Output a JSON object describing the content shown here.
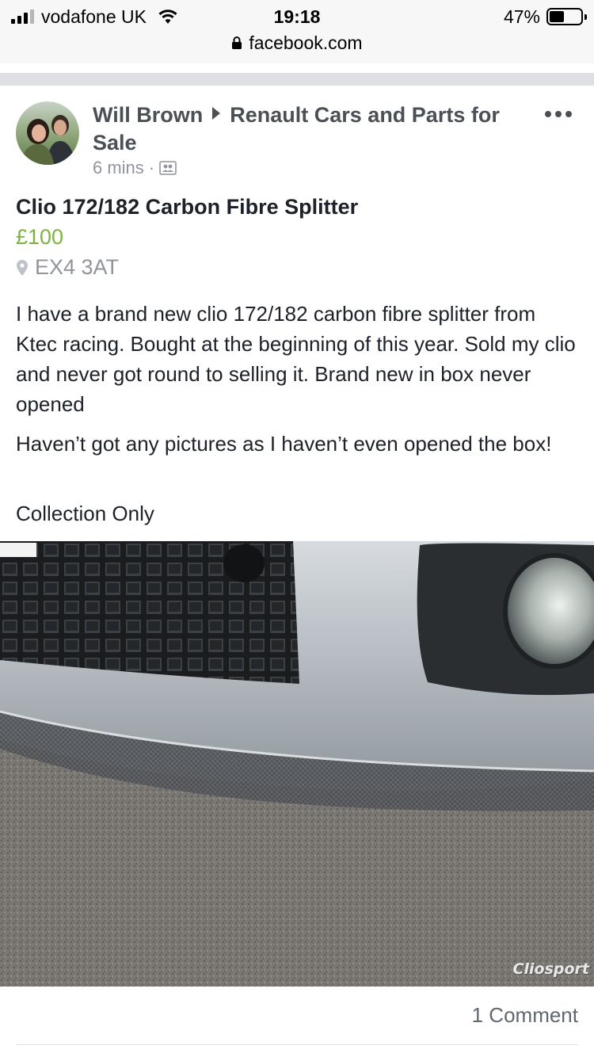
{
  "status_bar": {
    "carrier": "vodafone UK",
    "time": "19:18",
    "battery": "47%",
    "battery_level": 0.47,
    "url": "facebook.com"
  },
  "post": {
    "author": "Will Brown",
    "group": "Renault Cars and Parts for Sale",
    "time": "6 mins",
    "separator": "·",
    "audience_icon": "group-audience-icon",
    "more_icon": "more-options-icon"
  },
  "listing": {
    "title": "Clio 172/182 Carbon Fibre Splitter",
    "price": "£100",
    "location": "EX4 3AT",
    "paragraphs": [
      "I have a brand new clio 172/182 carbon fibre splitter from Ktec racing. Bought at the beginning of this year. Sold my clio and never got round to selling it. Brand new in box never opened",
      "Haven’t got any pictures as I haven’t even opened the box!",
      "Collection Only"
    ],
    "photo_watermark": "Cliosport"
  },
  "footer": {
    "comments": "1 Comment"
  },
  "colors": {
    "price": "#7cb342",
    "meta": "#90949c",
    "divider": "#dddfe2",
    "text": "#1d2129"
  }
}
